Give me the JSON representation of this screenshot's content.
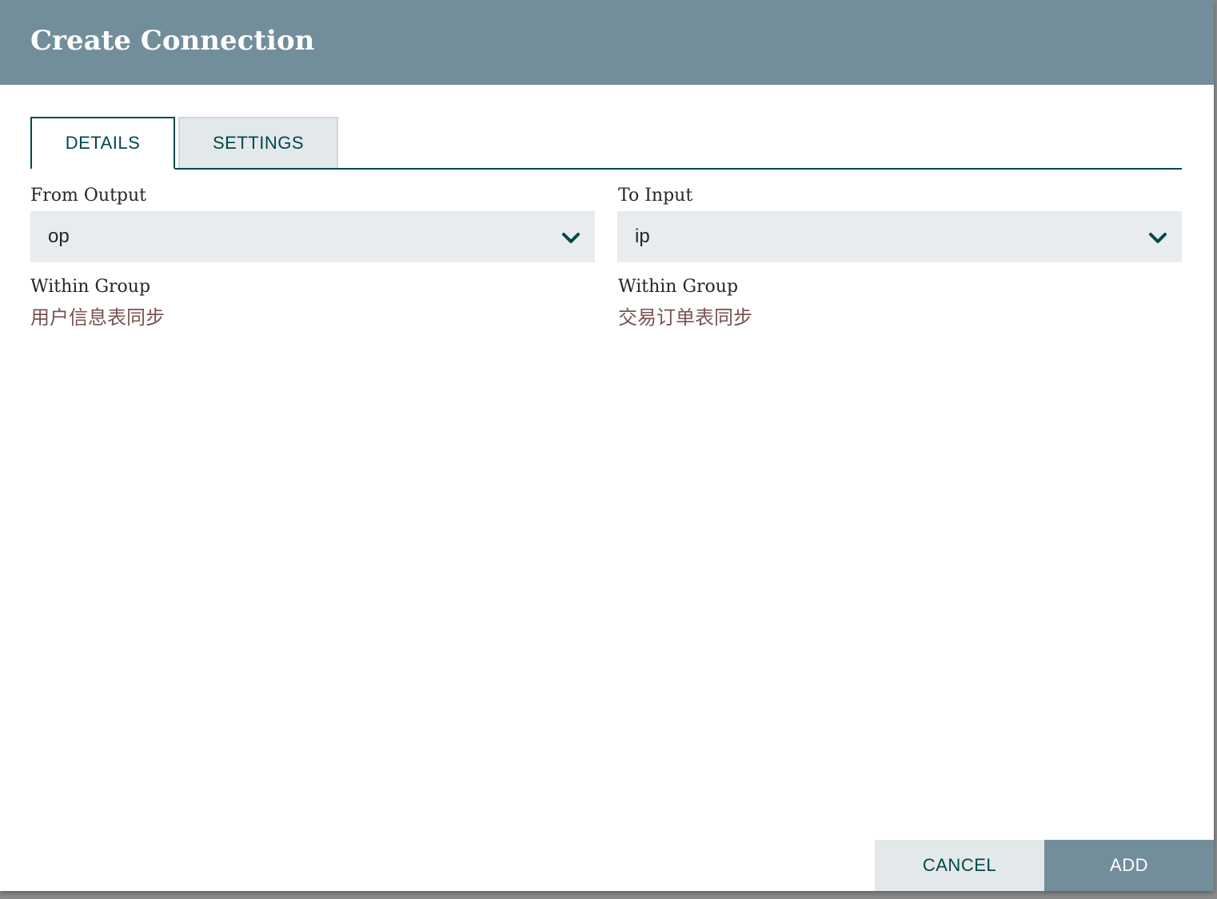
{
  "dialog": {
    "title": "Create Connection"
  },
  "tabs": [
    {
      "label": "DETAILS",
      "active": true
    },
    {
      "label": "SETTINGS",
      "active": false
    }
  ],
  "from": {
    "label": "From Output",
    "selected": "op",
    "group_label": "Within Group",
    "group_value": "用户信息表同步"
  },
  "to": {
    "label": "To Input",
    "selected": "ip",
    "group_label": "Within Group",
    "group_value": "交易订单表同步"
  },
  "buttons": {
    "cancel": "CANCEL",
    "add": "ADD"
  },
  "icons": {
    "dropdown": "chevron-down-icon"
  },
  "colors": {
    "header": "#728e9b",
    "accent": "#004849",
    "group_text": "#775351",
    "combo_bg": "#e8ecee"
  }
}
